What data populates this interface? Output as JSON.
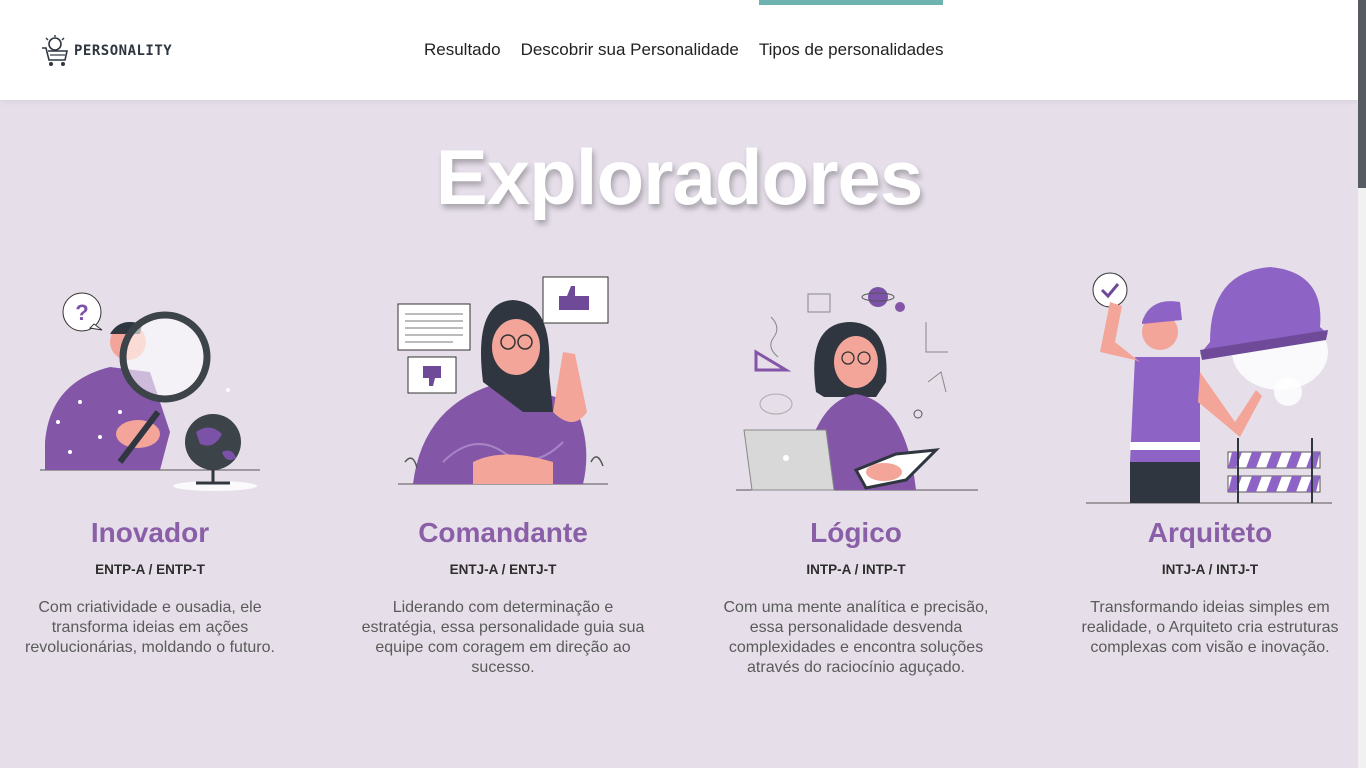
{
  "header": {
    "logo_text": "PERSONALITY",
    "nav": [
      {
        "label": "Resultado"
      },
      {
        "label": "Descobrir sua Personalidade"
      },
      {
        "label": "Tipos de personalidades",
        "active": true
      }
    ],
    "accent_color": "#6fb3b0"
  },
  "main": {
    "title": "Exploradores",
    "cards": [
      {
        "title": "Inovador",
        "code": "ENTP-A / ENTP-T",
        "description": "Com criatividade e ousadia, ele transforma ideias em ações revolucionárias, moldando o futuro.",
        "illustration": "magnifier-globe-illustration"
      },
      {
        "title": "Comandante",
        "code": "ENTJ-A / ENTJ-T",
        "description": "Liderando com determinação e estratégia, essa personalidade guia sua equipe com coragem em direção ao sucesso.",
        "illustration": "leader-thumbs-illustration"
      },
      {
        "title": "Lógico",
        "code": "INTP-A / INTP-T",
        "description": "Com uma mente analítica e precisão, essa personalidade desvenda complexidades e encontra soluções através do raciocínio aguçado.",
        "illustration": "scientist-laptop-illustration"
      },
      {
        "title": "Arquiteto",
        "code": "INTJ-A / INTJ-T",
        "description": "Transformando ideias simples em realidade, o Arquiteto cria estruturas complexas com visão e inovação.",
        "illustration": "builder-helmet-illustration"
      }
    ],
    "title_color": "#8b5fa8",
    "background_color": "#e6dfea"
  }
}
